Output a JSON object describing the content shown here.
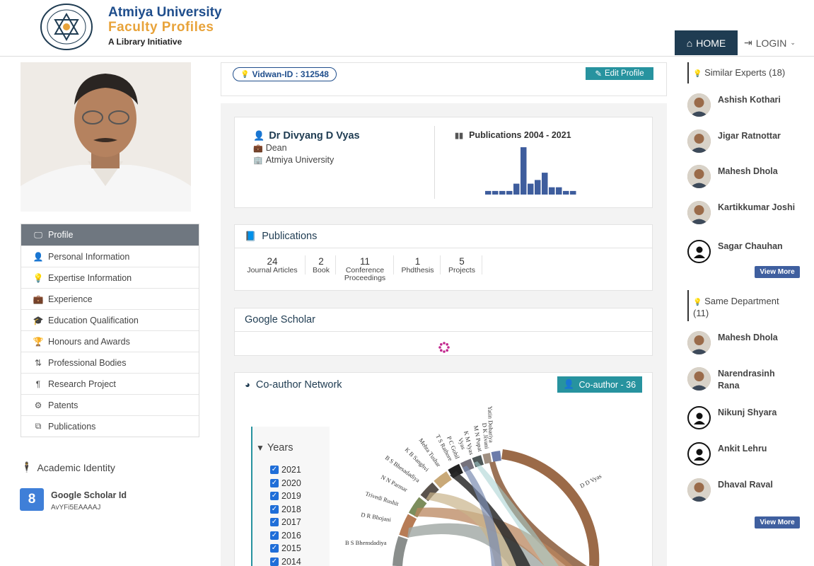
{
  "header": {
    "university": "Atmiya University",
    "portal": "Faculty Profiles",
    "tagline": "A Library Initiative",
    "nav_home": "HOME",
    "nav_login": "LOGIN"
  },
  "vidwan": {
    "id_label": "Vidwan-ID : 312548",
    "edit_label": "Edit Profile"
  },
  "profile": {
    "name": "Dr Divyang D Vyas",
    "designation": "Dean",
    "institution": "Atmiya University",
    "chart_title": "Publications 2004 - 2021"
  },
  "chart_data": {
    "type": "bar",
    "title": "Publications 2004 - 2021",
    "values": [
      1,
      1,
      1,
      1,
      3,
      13,
      3,
      4,
      6,
      2,
      2,
      1,
      1
    ],
    "ylim": [
      0,
      14
    ],
    "color": "#3e5d9d"
  },
  "menu": [
    {
      "label": "Profile",
      "icon": "monitor-icon",
      "glyph": "🖵",
      "active": true
    },
    {
      "label": "Personal Information",
      "icon": "user-icon",
      "glyph": "👤"
    },
    {
      "label": "Expertise Information",
      "icon": "lightbulb-icon",
      "glyph": "💡"
    },
    {
      "label": "Experience",
      "icon": "briefcase-icon",
      "glyph": "💼"
    },
    {
      "label": "Education Qualification",
      "icon": "graduation-cap-icon",
      "glyph": "🎓"
    },
    {
      "label": "Honours and Awards",
      "icon": "trophy-icon",
      "glyph": "🏆"
    },
    {
      "label": "Professional Bodies",
      "icon": "sort-icon",
      "glyph": "⇅"
    },
    {
      "label": "Research Project",
      "icon": "paragraph-icon",
      "glyph": "¶"
    },
    {
      "label": "Patents",
      "icon": "gears-icon",
      "glyph": "⚙"
    },
    {
      "label": "Publications",
      "icon": "copy-icon",
      "glyph": "⧉"
    }
  ],
  "academic": {
    "title": "Academic Identity",
    "scholar_title": "Google Scholar Id",
    "scholar_id": "AvYFi5EAAAAJ"
  },
  "publications": {
    "title": "Publications",
    "stats": [
      {
        "count": "24",
        "label1": "Journal Articles",
        "label2": ""
      },
      {
        "count": "2",
        "label1": "Book",
        "label2": ""
      },
      {
        "count": "11",
        "label1": "Conference",
        "label2": "Proceedings"
      },
      {
        "count": "1",
        "label1": "Phdthesis",
        "label2": ""
      },
      {
        "count": "5",
        "label1": "Projects",
        "label2": ""
      }
    ]
  },
  "scholar": {
    "title": "Google Scholar"
  },
  "coauthor": {
    "title": "Co-author Network",
    "count_label": "Co-author - 36",
    "years_title": "Years",
    "years": [
      "2021",
      "2020",
      "2019",
      "2018",
      "2017",
      "2016",
      "2015",
      "2014"
    ],
    "labels": {
      "dvyas": "D D Vyas",
      "bsb1": "B S Bhensdadiya",
      "bsb2": "B S Bhesadadiya",
      "drb": "D R Bhojani",
      "tr": "Trivedi Rushit",
      "nnp": "N N Parmar",
      "kbs": "K B Sanghvi",
      "mt": "Mehta Tushar",
      "tsr": "T S Rathore",
      "pcg": "P C Gohil",
      "vyas": "Vyas",
      "kmv": "K M Vyas",
      "mnp": "M N Popat",
      "dkj": "D K Jivani",
      "vd": "Yatin Dobariya"
    }
  },
  "similar": {
    "title": "Similar Experts (18)",
    "experts": [
      "Ashish Kothari",
      "Jigar Ratnottar",
      "Mahesh Dhola",
      "Kartikkumar Joshi",
      "Sagar Chauhan"
    ],
    "view_more": "View More"
  },
  "department": {
    "title": "Same Department (11)",
    "experts": [
      "Mahesh Dhola",
      "Narendrasinh Rana",
      "Nikunj Shyara",
      "Ankit Lehru",
      "Dhaval Raval"
    ],
    "view_more": "View More"
  }
}
